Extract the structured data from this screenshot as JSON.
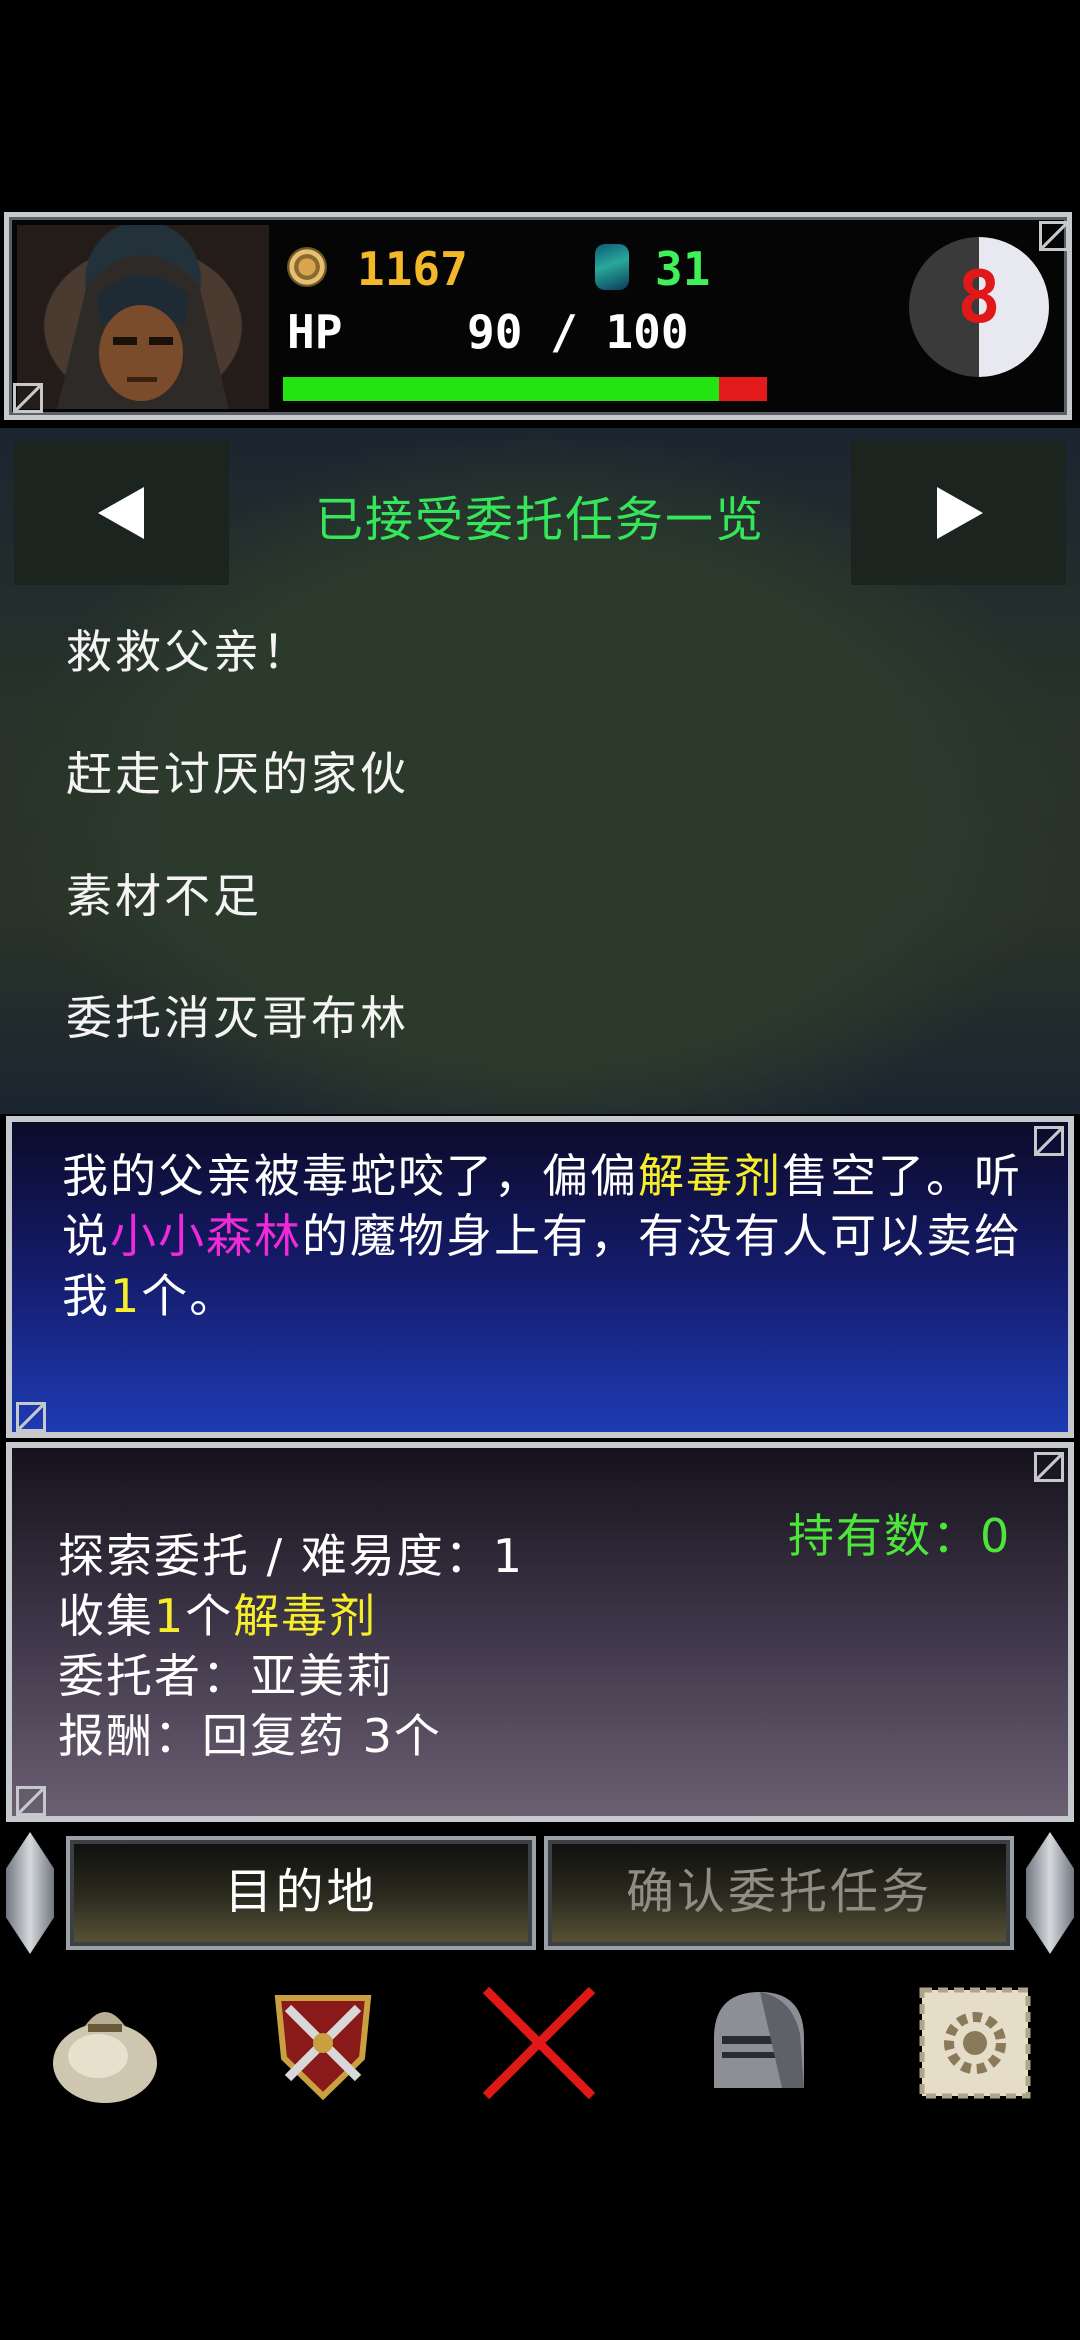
{
  "status": {
    "gold": "1167",
    "gems": "31",
    "hp_label": "HP",
    "hp_value": "90 / 100",
    "hp_fraction": 0.9,
    "moon_number": "8"
  },
  "quest_list": {
    "title": "已接受委托任务一览",
    "items": [
      "救救父亲！",
      "赶走讨厌的家伙",
      "素材不足",
      "委托消灭哥布林"
    ]
  },
  "description": {
    "part1": "我的父亲被毒蛇咬了，偏偏",
    "item1": "解毒剂",
    "part2": "售空了。听说",
    "location": "小小森林",
    "part3": "的魔物身上有，有没有人可以卖给我",
    "count": "1",
    "part4": "个。"
  },
  "details": {
    "owned": "持有数：0",
    "type_line": "探索委托 / 难易度：1",
    "collect_prefix": "收集",
    "collect_count": "1",
    "collect_mid": "个",
    "collect_item": "解毒剂",
    "client": "委托者：亚美莉",
    "reward": "报酬：回复药 3个"
  },
  "buttons": {
    "destination": "目的地",
    "confirm": "确认委托任务"
  },
  "nav_icons": [
    "bag-icon",
    "crest-swords-icon",
    "close-x-icon",
    "knight-helmet-icon",
    "gear-scroll-icon"
  ],
  "colors": {
    "accent_green": "#35e65a",
    "gold_text": "#f2b82a",
    "gem_text": "#3ff05a",
    "highlight_yellow": "#f6ee2a",
    "highlight_magenta": "#ef2bd9",
    "disabled_text": "#8e8e84"
  }
}
